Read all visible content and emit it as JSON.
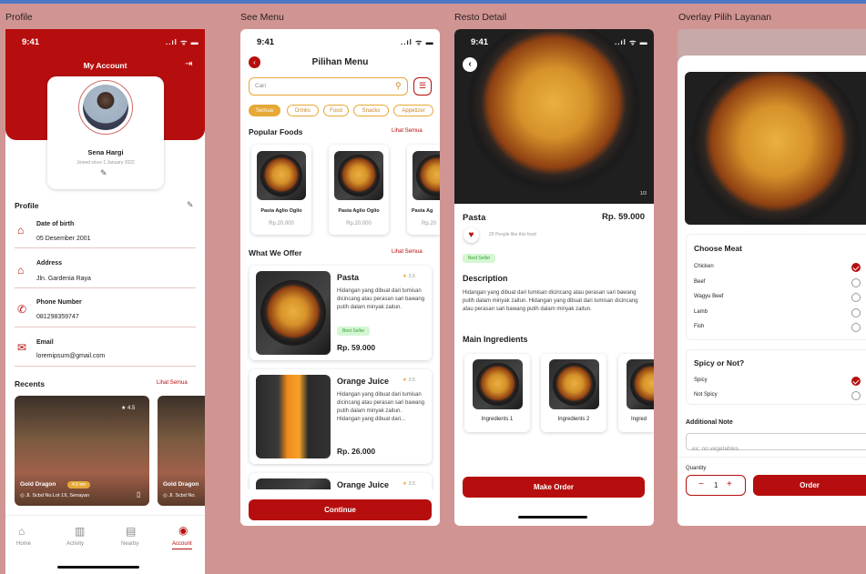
{
  "frames": {
    "profile": "Profile",
    "menu": "See Menu",
    "detail": "Resto Detail",
    "overlay": "Overlay Pilih Layanan"
  },
  "status": {
    "time": "9:41",
    "icons": "..ıl ᯤ ▬"
  },
  "profile": {
    "title": "My Account",
    "name": "Sena Hargi",
    "joined": "Joined since 1 January 2022",
    "section": "Profile",
    "fields": [
      {
        "label": "Date of birth",
        "value": "05 Desember 2001"
      },
      {
        "label": "Address",
        "value": "Jln. Gardenia Raya"
      },
      {
        "label": "Phone Number",
        "value": "081298359747"
      },
      {
        "label": "Email",
        "value": "loremipsum@gmail.com"
      }
    ],
    "recents": "Recents",
    "see_all": "Lihat Semua",
    "resto": {
      "name": "Gold Dragon",
      "distance": "4,6 km",
      "rating": "4.5",
      "address": "Jl. Scbd No.Lot 19, Senayan",
      "name2": "Gold Dragon",
      "address2": "Jl. Scbd No."
    },
    "nav": [
      "Home",
      "Activity",
      "Nearby",
      "Account"
    ]
  },
  "menu": {
    "title": "Pilihan Menu",
    "search_placeholder": "Cari",
    "chips": [
      "Semua",
      "Drinks",
      "Food",
      "Snacks",
      "Appetizer"
    ],
    "popular": "Popular Foods",
    "see_all": "Lihat Semua",
    "popular_items": [
      {
        "name": "Pasta Aglio Oglio",
        "price": "Rp.20.000"
      },
      {
        "name": "Pasta Aglio Oglio",
        "price": "Rp.20.000"
      },
      {
        "name": "Pasta Ag",
        "price": "Rp.20"
      }
    ],
    "offer": "What We Offer",
    "offer_all": "Lihat Semua",
    "offers": [
      {
        "name": "Pasta",
        "rating": "3.5",
        "desc": "Hidangan yang dibuat dari tumisan dicincang atau perasan sari bawang putih dalam minyak zaitun.",
        "badge": "Best Seller",
        "price": "Rp. 59.000"
      },
      {
        "name": "Orange Juice",
        "rating": "3.5",
        "desc": "Hidangan yang dibuat dari tumisan dicincang atau perasan sari bawang putih dalam minyak zaitun. Hidangan yang dibuat dari...",
        "price": "Rp. 26.000"
      },
      {
        "name": "Orange Juice",
        "rating": "3.5"
      }
    ],
    "continue": "Continue"
  },
  "detail": {
    "counter": "1/3",
    "name": "Pasta",
    "price": "Rp. 59.000",
    "likes": "29 People like this food",
    "badge": "Best Seller",
    "desc_title": "Description",
    "desc": "Hidangan yang dibuat dari tumisan dicincang atau perasan sari bawang putih dalam minyak zaitun. Hidangan yang dibuat dari tumisan dicincang atau perasan sari bawang putih dalam minyak zaitun.",
    "ingredients_title": "Main Ingredients",
    "ingredients": [
      "Ingredients 1",
      "Ingredients 2",
      "Ingred"
    ],
    "make_order": "Make Order"
  },
  "overlay": {
    "meat_title": "Choose Meat",
    "meats": [
      "Chicken",
      "Beef",
      "Wagyu Beef",
      "Lamb",
      "Fish"
    ],
    "spicy_title": "Spicy or Not?",
    "spicy": [
      "Spicy",
      "Not Spicy"
    ],
    "additional": "Additional Note",
    "note_placeholder": "ex: no vegetables",
    "quantity_label": "Quantity",
    "quantity": "1",
    "order": "Order"
  },
  "colors": {
    "primary": "#b60e0e",
    "accent": "#e6a836",
    "background": "#d09593"
  }
}
